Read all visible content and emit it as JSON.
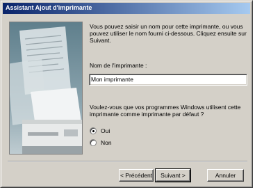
{
  "window": {
    "title": "Assistant Ajout d'imprimante"
  },
  "instructions": "Vous pouvez saisir un nom pour cette imprimante, ou vous pouvez utiliser le nom fourni ci-dessous. Cliquez ensuite sur Suivant.",
  "printer_name": {
    "label": "Nom de l'imprimante :",
    "value": "Mon imprimante"
  },
  "default_question": "Voulez-vous que vos programmes Windows utilisent cette imprimante comme imprimante par défaut ?",
  "options": [
    {
      "label": "Oui",
      "selected": true
    },
    {
      "label": "Non",
      "selected": false
    }
  ],
  "buttons": {
    "back": "< Précédent",
    "next": "Suivant >",
    "cancel": "Annuler"
  }
}
